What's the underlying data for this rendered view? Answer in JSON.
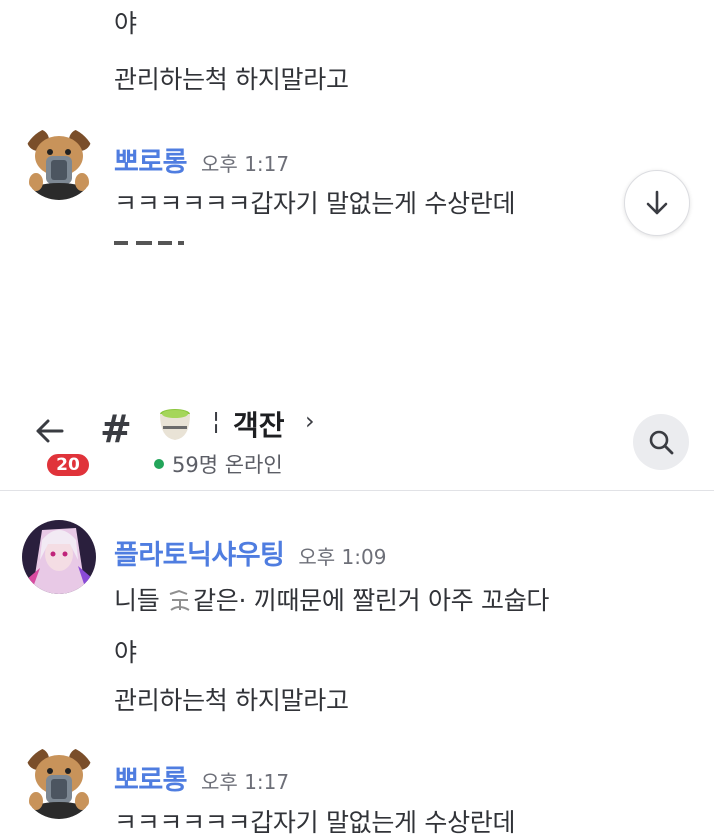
{
  "top": {
    "line1": "야",
    "line2": "관리하는척 하지말라고",
    "message": {
      "author": "뽀로롱",
      "time": "오후 1:17",
      "text": "ㅋㅋㅋㅋㅋㅋ갑자기 말없는게 수상란데"
    },
    "scroll_down_icon": "arrow-down-icon"
  },
  "header": {
    "back_icon": "arrow-left-icon",
    "unread_badge": "20",
    "hash": "#",
    "channel_emoji": "tea-cup-icon",
    "separator": "¦",
    "channel_name": "객잔",
    "chevron": "›",
    "online": "59명 온라인",
    "search_icon": "search-icon"
  },
  "messages": [
    {
      "author": "플라토닉샤우팅",
      "time": "오후 1:09",
      "lines": [
        "니들 ",
        "같은",
        "  끼때문에 짤린거 아주 꼬숩다",
        "야",
        "관리하는척 하지말라고"
      ]
    },
    {
      "author": "뽀로롱",
      "time": "오후 1:17",
      "lines": [
        "ㅋㅋㅋㅋㅋㅋ갑자기 말없는게 수상란데"
      ]
    }
  ],
  "colors": {
    "author": "#4f7de0",
    "badge": "#e0333a",
    "online": "#23a55a"
  }
}
